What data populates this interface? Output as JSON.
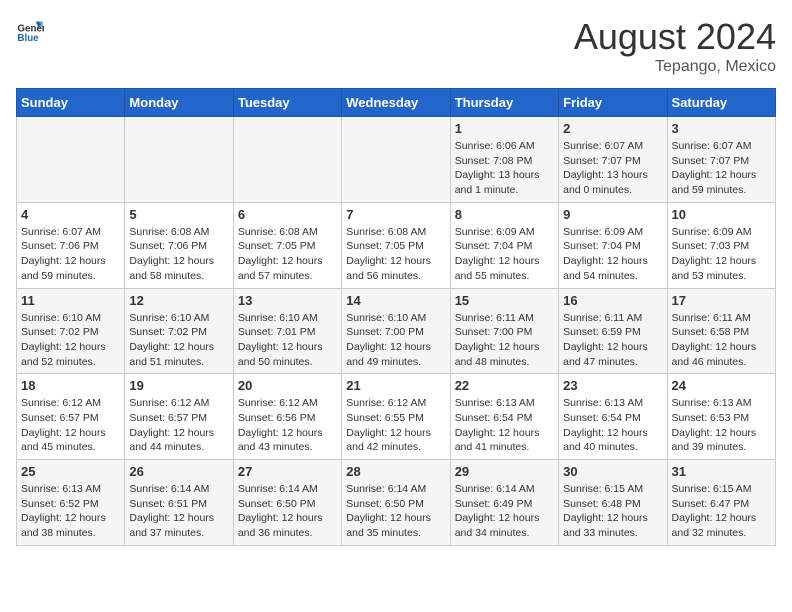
{
  "header": {
    "logo_general": "General",
    "logo_blue": "Blue",
    "month_year": "August 2024",
    "location": "Tepango, Mexico"
  },
  "days_of_week": [
    "Sunday",
    "Monday",
    "Tuesday",
    "Wednesday",
    "Thursday",
    "Friday",
    "Saturday"
  ],
  "weeks": [
    [
      {
        "day": "",
        "info": ""
      },
      {
        "day": "",
        "info": ""
      },
      {
        "day": "",
        "info": ""
      },
      {
        "day": "",
        "info": ""
      },
      {
        "day": "1",
        "info": "Sunrise: 6:06 AM\nSunset: 7:08 PM\nDaylight: 13 hours\nand 1 minute."
      },
      {
        "day": "2",
        "info": "Sunrise: 6:07 AM\nSunset: 7:07 PM\nDaylight: 13 hours\nand 0 minutes."
      },
      {
        "day": "3",
        "info": "Sunrise: 6:07 AM\nSunset: 7:07 PM\nDaylight: 12 hours\nand 59 minutes."
      }
    ],
    [
      {
        "day": "4",
        "info": "Sunrise: 6:07 AM\nSunset: 7:06 PM\nDaylight: 12 hours\nand 59 minutes."
      },
      {
        "day": "5",
        "info": "Sunrise: 6:08 AM\nSunset: 7:06 PM\nDaylight: 12 hours\nand 58 minutes."
      },
      {
        "day": "6",
        "info": "Sunrise: 6:08 AM\nSunset: 7:05 PM\nDaylight: 12 hours\nand 57 minutes."
      },
      {
        "day": "7",
        "info": "Sunrise: 6:08 AM\nSunset: 7:05 PM\nDaylight: 12 hours\nand 56 minutes."
      },
      {
        "day": "8",
        "info": "Sunrise: 6:09 AM\nSunset: 7:04 PM\nDaylight: 12 hours\nand 55 minutes."
      },
      {
        "day": "9",
        "info": "Sunrise: 6:09 AM\nSunset: 7:04 PM\nDaylight: 12 hours\nand 54 minutes."
      },
      {
        "day": "10",
        "info": "Sunrise: 6:09 AM\nSunset: 7:03 PM\nDaylight: 12 hours\nand 53 minutes."
      }
    ],
    [
      {
        "day": "11",
        "info": "Sunrise: 6:10 AM\nSunset: 7:02 PM\nDaylight: 12 hours\nand 52 minutes."
      },
      {
        "day": "12",
        "info": "Sunrise: 6:10 AM\nSunset: 7:02 PM\nDaylight: 12 hours\nand 51 minutes."
      },
      {
        "day": "13",
        "info": "Sunrise: 6:10 AM\nSunset: 7:01 PM\nDaylight: 12 hours\nand 50 minutes."
      },
      {
        "day": "14",
        "info": "Sunrise: 6:10 AM\nSunset: 7:00 PM\nDaylight: 12 hours\nand 49 minutes."
      },
      {
        "day": "15",
        "info": "Sunrise: 6:11 AM\nSunset: 7:00 PM\nDaylight: 12 hours\nand 48 minutes."
      },
      {
        "day": "16",
        "info": "Sunrise: 6:11 AM\nSunset: 6:59 PM\nDaylight: 12 hours\nand 47 minutes."
      },
      {
        "day": "17",
        "info": "Sunrise: 6:11 AM\nSunset: 6:58 PM\nDaylight: 12 hours\nand 46 minutes."
      }
    ],
    [
      {
        "day": "18",
        "info": "Sunrise: 6:12 AM\nSunset: 6:57 PM\nDaylight: 12 hours\nand 45 minutes."
      },
      {
        "day": "19",
        "info": "Sunrise: 6:12 AM\nSunset: 6:57 PM\nDaylight: 12 hours\nand 44 minutes."
      },
      {
        "day": "20",
        "info": "Sunrise: 6:12 AM\nSunset: 6:56 PM\nDaylight: 12 hours\nand 43 minutes."
      },
      {
        "day": "21",
        "info": "Sunrise: 6:12 AM\nSunset: 6:55 PM\nDaylight: 12 hours\nand 42 minutes."
      },
      {
        "day": "22",
        "info": "Sunrise: 6:13 AM\nSunset: 6:54 PM\nDaylight: 12 hours\nand 41 minutes."
      },
      {
        "day": "23",
        "info": "Sunrise: 6:13 AM\nSunset: 6:54 PM\nDaylight: 12 hours\nand 40 minutes."
      },
      {
        "day": "24",
        "info": "Sunrise: 6:13 AM\nSunset: 6:53 PM\nDaylight: 12 hours\nand 39 minutes."
      }
    ],
    [
      {
        "day": "25",
        "info": "Sunrise: 6:13 AM\nSunset: 6:52 PM\nDaylight: 12 hours\nand 38 minutes."
      },
      {
        "day": "26",
        "info": "Sunrise: 6:14 AM\nSunset: 6:51 PM\nDaylight: 12 hours\nand 37 minutes."
      },
      {
        "day": "27",
        "info": "Sunrise: 6:14 AM\nSunset: 6:50 PM\nDaylight: 12 hours\nand 36 minutes."
      },
      {
        "day": "28",
        "info": "Sunrise: 6:14 AM\nSunset: 6:50 PM\nDaylight: 12 hours\nand 35 minutes."
      },
      {
        "day": "29",
        "info": "Sunrise: 6:14 AM\nSunset: 6:49 PM\nDaylight: 12 hours\nand 34 minutes."
      },
      {
        "day": "30",
        "info": "Sunrise: 6:15 AM\nSunset: 6:48 PM\nDaylight: 12 hours\nand 33 minutes."
      },
      {
        "day": "31",
        "info": "Sunrise: 6:15 AM\nSunset: 6:47 PM\nDaylight: 12 hours\nand 32 minutes."
      }
    ]
  ]
}
